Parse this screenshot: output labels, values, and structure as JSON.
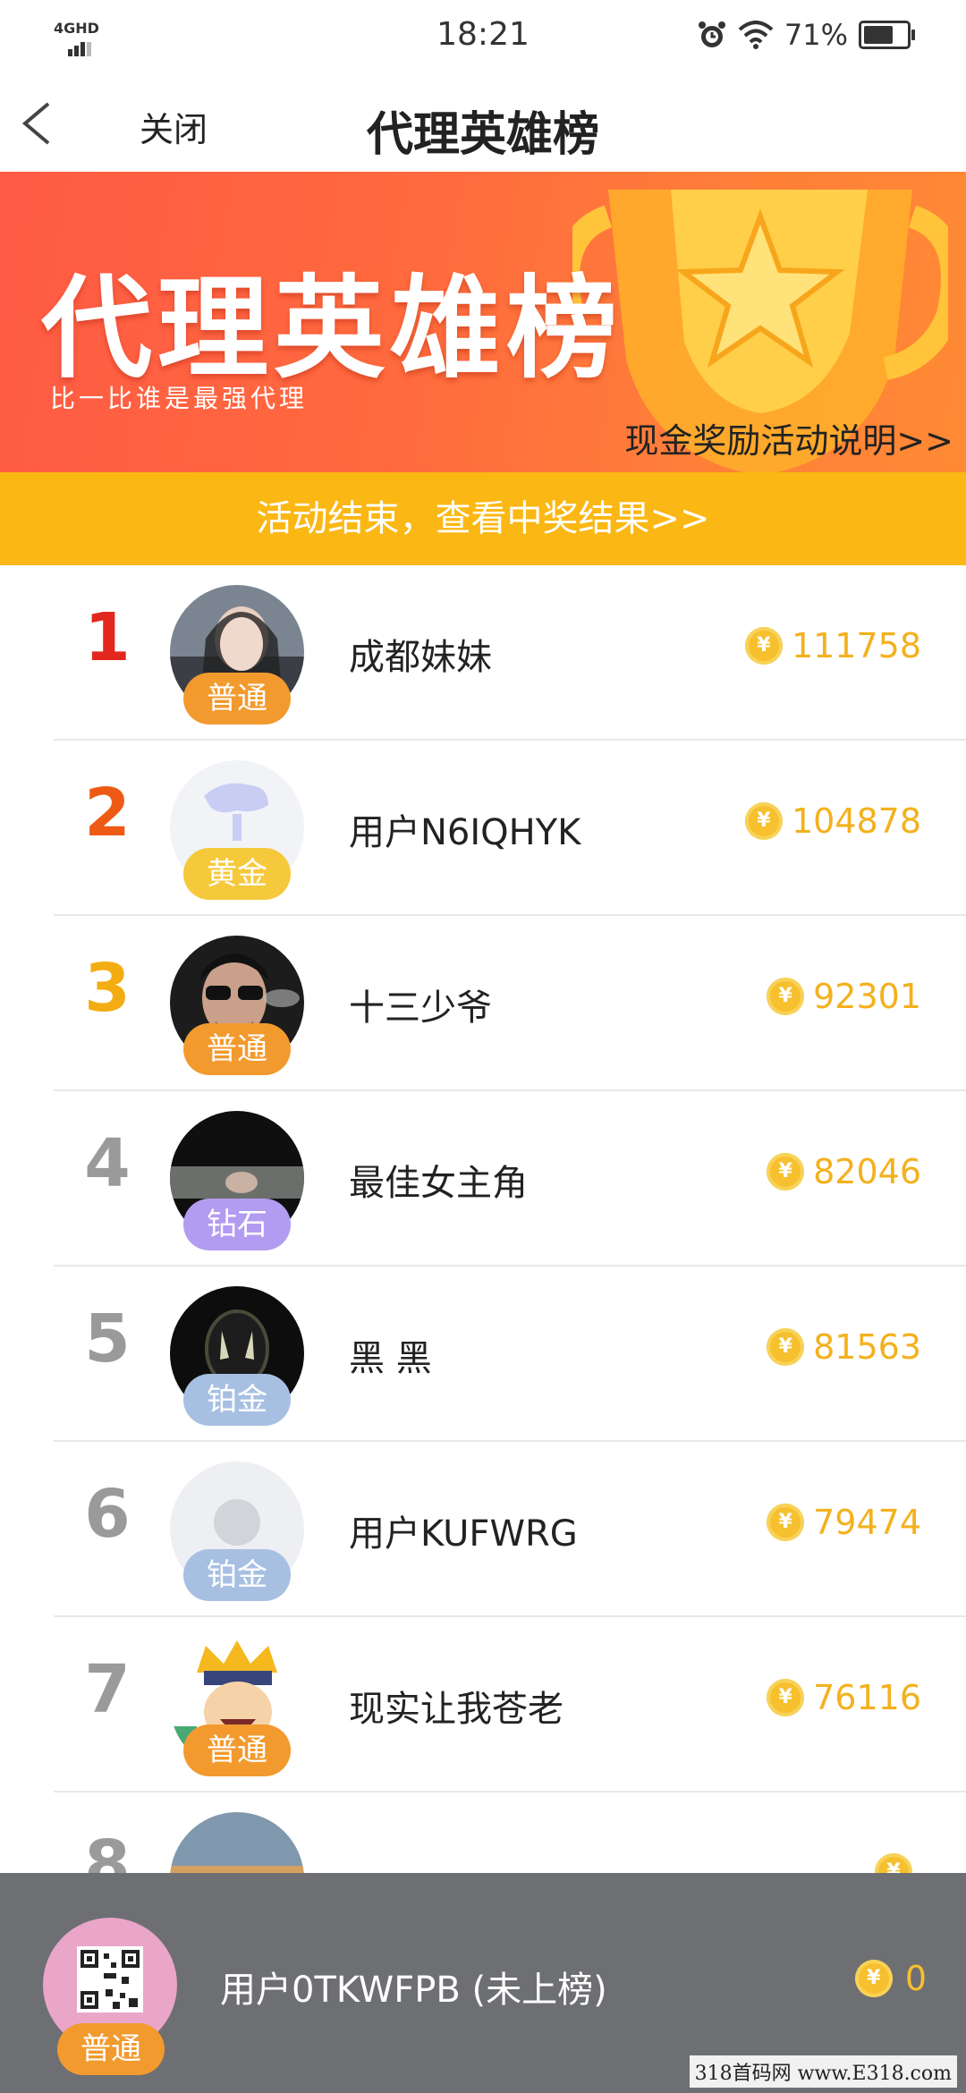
{
  "status_bar": {
    "network": "4GHD",
    "time": "18:21",
    "battery": "71%"
  },
  "nav": {
    "close_label": "关闭",
    "title": "代理英雄榜"
  },
  "banner": {
    "title": "代理英雄榜",
    "subtitle": "比一比谁是最强代理",
    "rules_link": "现金奖励活动说明>>"
  },
  "activity": {
    "text": "活动结束，查看中奖结果>>"
  },
  "ranking": [
    {
      "rank": "1",
      "name": "成都妹妹",
      "badge": "普通",
      "score": "111758"
    },
    {
      "rank": "2",
      "name": "用户N6IQHYK",
      "badge": "黄金",
      "score": "104878"
    },
    {
      "rank": "3",
      "name": "十三少爷",
      "badge": "普通",
      "score": "92301"
    },
    {
      "rank": "4",
      "name": "最佳女主角",
      "badge": "钻石",
      "score": "82046"
    },
    {
      "rank": "5",
      "name": "黑 黑",
      "badge": "铂金",
      "score": "81563"
    },
    {
      "rank": "6",
      "name": "用户KUFWRG",
      "badge": "铂金",
      "score": "79474"
    },
    {
      "rank": "7",
      "name": "现实让我苍老",
      "badge": "普通",
      "score": "76116"
    },
    {
      "rank": "8",
      "name": "",
      "badge": "",
      "score": ""
    }
  ],
  "me": {
    "name": "用户0TKWFPB (未上榜)",
    "badge": "普通",
    "score": "0"
  },
  "coin_symbol": "¥",
  "watermark": "318首码网 www.E318.com",
  "colors": {
    "accent": "#fbb713",
    "banner": "#ff6b3d",
    "coin": "#f6c02e"
  }
}
